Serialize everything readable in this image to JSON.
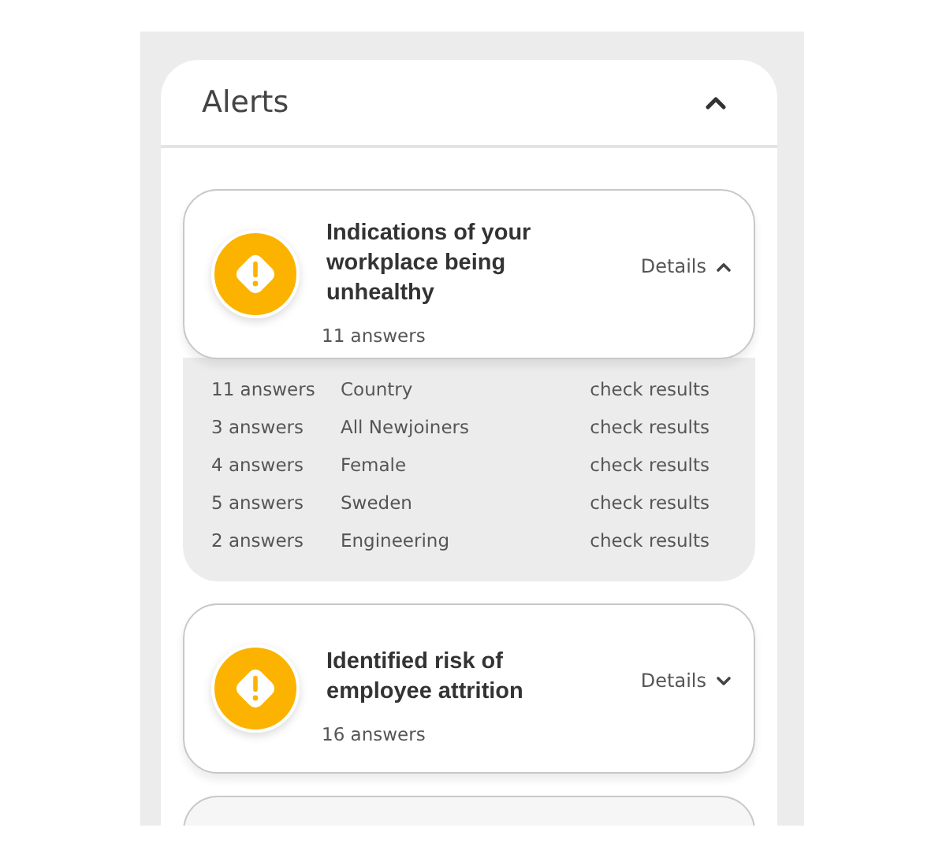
{
  "panel": {
    "title": "Alerts",
    "expanded": true
  },
  "alerts": [
    {
      "title": "Indications of your workplace being unhealthy",
      "answers": "11 answers",
      "details_label": "Details",
      "expanded": true,
      "breakdown": [
        {
          "answers": "11 answers",
          "group": "Country",
          "action": "check results"
        },
        {
          "answers": "3 answers",
          "group": "All Newjoiners",
          "action": "check results"
        },
        {
          "answers": "4 answers",
          "group": "Female",
          "action": "check results"
        },
        {
          "answers": "5 answers",
          "group": "Sweden",
          "action": "check results"
        },
        {
          "answers": "2 answers",
          "group": "Engineering",
          "action": "check results"
        }
      ]
    },
    {
      "title": "Identified risk of employee attrition",
      "answers": "16 answers",
      "details_label": "Details",
      "expanded": false
    }
  ]
}
